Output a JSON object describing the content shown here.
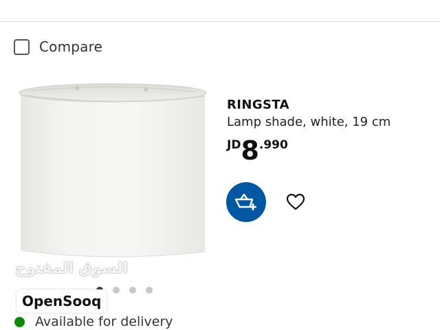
{
  "compare": {
    "label": "Compare",
    "checked": false
  },
  "product": {
    "name": "RINGSTA",
    "description": "Lamp shade, white, 19 cm",
    "price": {
      "currency": "JD",
      "integer": "8",
      "decimal": ".990"
    }
  },
  "actions": {
    "add_to_cart_icon": "basket-plus-icon",
    "favorite_icon": "heart-icon"
  },
  "carousel": {
    "dot_count": 4,
    "active_index": 0
  },
  "watermark": {
    "arabic": "السوق المفتوح",
    "english": "OpenSooq"
  },
  "availability": {
    "label": "Available for delivery",
    "status_color": "#0a8a00"
  },
  "colors": {
    "accent": "#0058a3"
  }
}
